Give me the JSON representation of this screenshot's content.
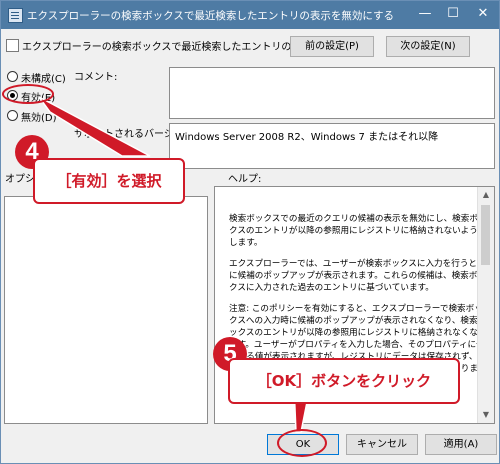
{
  "window": {
    "title": "エクスプローラーの検索ボックスで最近検索したエントリの表示を無効にする",
    "minimize": "—",
    "maximize": "☐",
    "close": "✕"
  },
  "header": {
    "policy_name": "エクスプローラーの検索ボックスで最近検索したエントリの表示を無効にする",
    "prev_button": "前の設定(P)",
    "next_button": "次の設定(N)"
  },
  "options": {
    "not_configured": "未構成(C)",
    "enabled": "有効(E)",
    "disabled": "無効(D)",
    "selected": "enabled"
  },
  "comment_label": "コメント:",
  "supported_label": "サポートされるバージョン:",
  "supported_value": "Windows Server 2008 R2、Windows 7 またはそれ以降",
  "options_label": "オプション:",
  "help_label": "ヘルプ:",
  "help_text": [
    "検索ボックスでの最近のクエリの候補の表示を無効にし、検索ボックスのエントリが以降の参照用にレジストリに格納されないようにします。",
    "エクスプローラーでは、ユーザーが検索ボックスに入力を行うときに候補のポップアップが表示されます。これらの候補は、検索ボックスに入力された過去のエントリに基づいています。",
    "注意: このポリシーを有効にすると、エクスプローラーで検索ボックスへの入力時に候補のポップアップが表示されなくなり、検索ボックスのエントリが以降の参照用にレジストリに格納されなくなります。ユーザーがプロパティを入力した場合、そのプロパティに一致する値が表示されますが、レジストリにデータは保存されず、それ以降に検索ボックスを使用したときに表示されることはありません。"
  ],
  "footer": {
    "ok": "OK",
    "cancel": "キャンセル",
    "apply": "適用(A)"
  },
  "annotations": {
    "step4_number": "4",
    "step4_text": "［有効］を選択",
    "step5_number": "5",
    "step5_text": "［OK］ボタンをクリック",
    "color": "#d01a28"
  }
}
